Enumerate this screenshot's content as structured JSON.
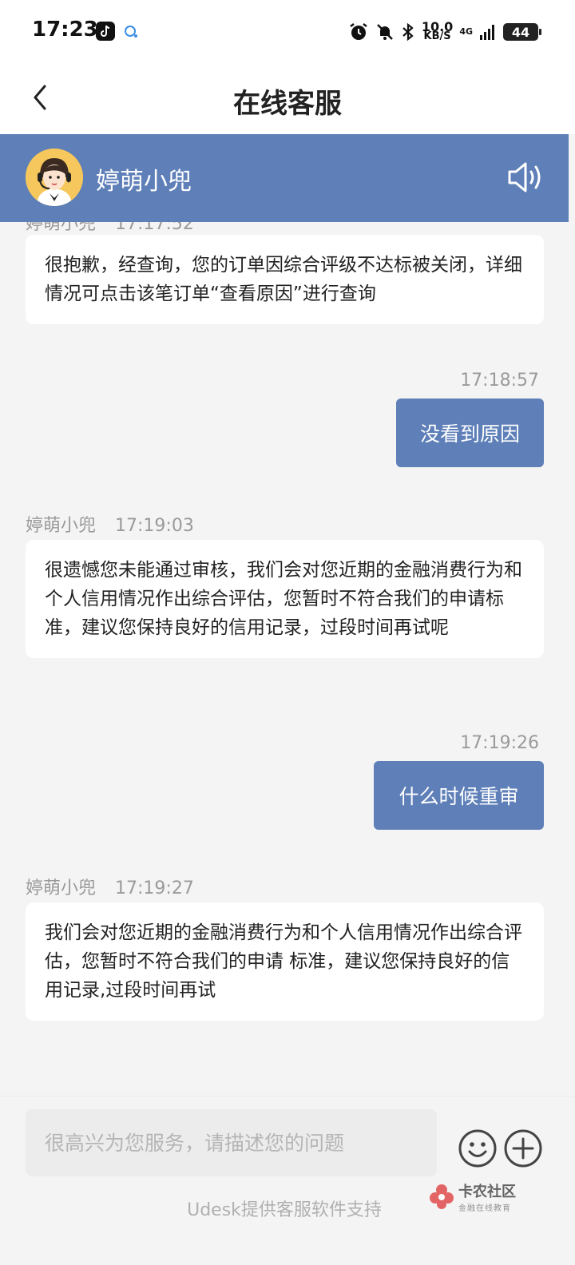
{
  "status_bar": {
    "time": "17:23",
    "net_speed_value": "10.0",
    "net_speed_unit": "KB/S",
    "network": "4G",
    "battery": "44"
  },
  "header": {
    "title": "在线客服"
  },
  "agent": {
    "name": "婷萌小兜"
  },
  "messages": [
    {
      "side": "in",
      "text": "很抱歉，经查询，您的订单因综合评级不达标被关闭，详细情况可点击该笔订单“查看原因”进行查询"
    },
    {
      "side": "out",
      "time": "17:18:57",
      "text": "没看到原因"
    },
    {
      "side": "in",
      "name": "婷萌小兜",
      "time": "17:19:03",
      "text": "很遗憾您未能通过审核，我们会对您近期的金融消费行为和个人信用情况作出综合评估，您暂时不符合我们的申请标准，建议您保持良好的信用记录，过段时间再试呢"
    },
    {
      "side": "out",
      "time": "17:19:26",
      "text": "什么时候重审"
    },
    {
      "side": "in",
      "name": "婷萌小兜",
      "time": "17:19:27",
      "text": "我们会对您近期的金融消费行为和个人信用情况作出综合评估，您暂时不符合我们的申请 标准，建议您保持良好的信用记录,过段时间再试"
    }
  ],
  "input": {
    "placeholder": "很高兴为您服务，请描述您的问题"
  },
  "footer": {
    "powered_by": "Udesk提供客服软件支持"
  },
  "watermark": {
    "title": "卡农社区",
    "subtitle": "金融在线教育"
  },
  "colors": {
    "brand": "#5e7fb8",
    "background": "#f4f4f4",
    "bubble_in": "#ffffff",
    "meta_text": "#9a9a9a"
  },
  "icons": {
    "back": "chevron-left-icon",
    "sound": "speaker-icon",
    "emoji": "smiley-icon",
    "plus": "plus-circle-icon"
  }
}
